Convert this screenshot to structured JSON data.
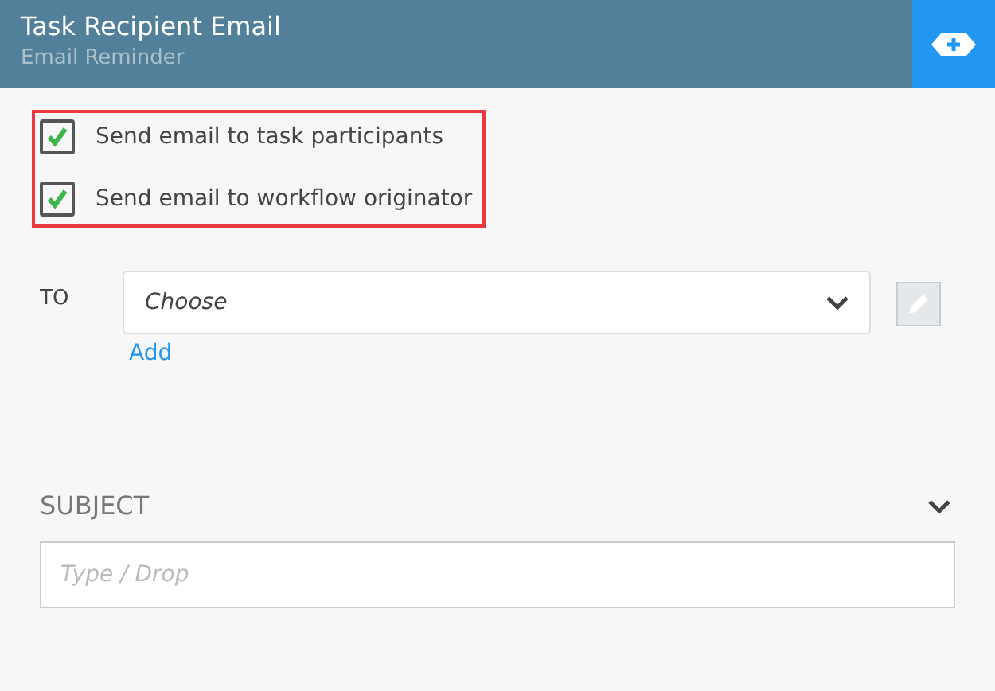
{
  "header": {
    "title": "Task Recipient Email",
    "subtitle": "Email Reminder"
  },
  "options": [
    {
      "label": "Send email to task participants",
      "checked": true
    },
    {
      "label": "Send email to workflow originator",
      "checked": true
    }
  ],
  "to": {
    "label": "TO",
    "value": "Choose",
    "add_link": "Add"
  },
  "subject": {
    "label": "SUBJECT",
    "expanded": false,
    "placeholder": "Type / Drop"
  }
}
